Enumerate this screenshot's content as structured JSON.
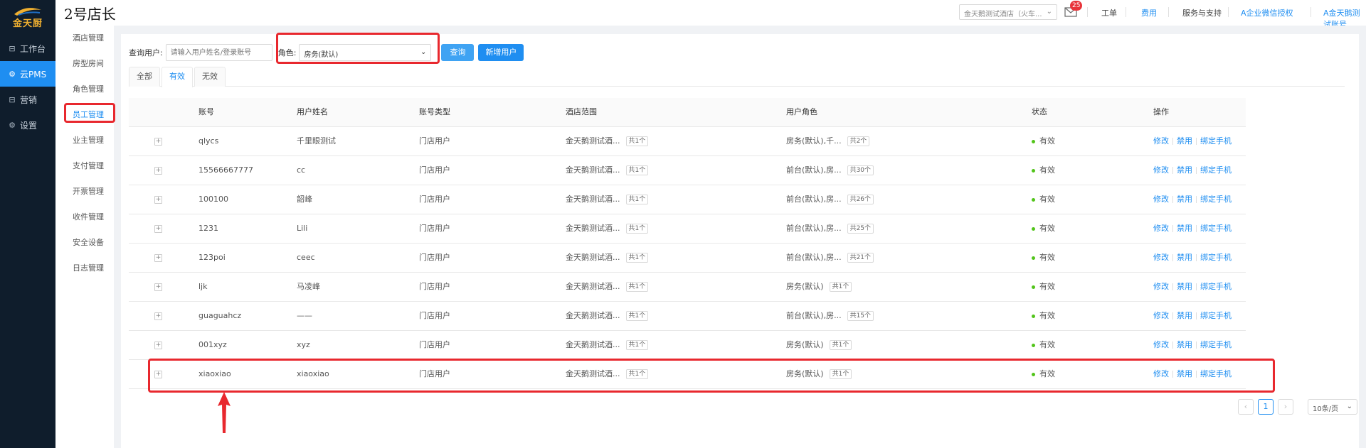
{
  "nav": {
    "brand": "金天厨",
    "items": [
      {
        "icon": "workbench-icon",
        "glyph": "⊟",
        "label": "工作台"
      },
      {
        "icon": "cloud-settings-icon",
        "glyph": "⚙",
        "label": "云PMS"
      },
      {
        "icon": "marketing-icon",
        "glyph": "⊟",
        "label": "营销"
      },
      {
        "icon": "settings-icon",
        "glyph": "⚙",
        "label": "设置"
      }
    ]
  },
  "header": {
    "store_name": "2号店长",
    "hotel_select": "金天鹅测试酒店（火车...",
    "mail_badge": "25",
    "links": {
      "work_order": "工单",
      "fees": "费用",
      "service": "服务与支持",
      "wechat": "A企业微信授权",
      "account": "A金天鹅测试账号"
    }
  },
  "submenu": [
    "酒店管理",
    "房型房间",
    "角色管理",
    "员工管理",
    "业主管理",
    "支付管理",
    "开票管理",
    "收件管理",
    "安全设备",
    "日志管理"
  ],
  "filter": {
    "user_label": "查询用户:",
    "user_placeholder": "请输入用户姓名/登录账号",
    "role_label": "角色:",
    "role_value": "房务(默认)",
    "query_button": "查询",
    "add_button": "新增用户"
  },
  "tabs": [
    "全部",
    "有效",
    "无效"
  ],
  "table": {
    "columns": [
      "账号",
      "用户姓名",
      "账号类型",
      "酒店范围",
      "用户角色",
      "状态",
      "操作"
    ],
    "actions": [
      "修改",
      "禁用",
      "绑定手机"
    ],
    "rows": [
      {
        "account": "qlycs",
        "name": "千里眼测试",
        "type": "门店用户",
        "hotel": "金天鹅测试酒...",
        "hotel_count": "共1个",
        "role": "房务(默认),千...",
        "role_count": "共2个",
        "status": "有效"
      },
      {
        "account": "15566667777",
        "name": "cc",
        "type": "门店用户",
        "hotel": "金天鹅测试酒...",
        "hotel_count": "共1个",
        "role": "前台(默认),房...",
        "role_count": "共30个",
        "status": "有效"
      },
      {
        "account": "100100",
        "name": "韶峰",
        "type": "门店用户",
        "hotel": "金天鹅测试酒...",
        "hotel_count": "共1个",
        "role": "前台(默认),房...",
        "role_count": "共26个",
        "status": "有效"
      },
      {
        "account": "1231",
        "name": "Lili",
        "type": "门店用户",
        "hotel": "金天鹅测试酒...",
        "hotel_count": "共1个",
        "role": "前台(默认),房...",
        "role_count": "共25个",
        "status": "有效"
      },
      {
        "account": "123poi",
        "name": "ceec",
        "type": "门店用户",
        "hotel": "金天鹅测试酒...",
        "hotel_count": "共1个",
        "role": "前台(默认),房...",
        "role_count": "共21个",
        "status": "有效"
      },
      {
        "account": "ljk",
        "name": "马凌峰",
        "type": "门店用户",
        "hotel": "金天鹅测试酒...",
        "hotel_count": "共1个",
        "role": "房务(默认)",
        "role_count": "共1个",
        "status": "有效"
      },
      {
        "account": "guaguahcz",
        "name": "——",
        "type": "门店用户",
        "hotel": "金天鹅测试酒...",
        "hotel_count": "共1个",
        "role": "前台(默认),房...",
        "role_count": "共15个",
        "status": "有效"
      },
      {
        "account": "001xyz",
        "name": "xyz",
        "type": "门店用户",
        "hotel": "金天鹅测试酒...",
        "hotel_count": "共1个",
        "role": "房务(默认)",
        "role_count": "共1个",
        "status": "有效"
      },
      {
        "account": "xiaoxiao",
        "name": "xiaoxiao",
        "type": "门店用户",
        "hotel": "金天鹅测试酒...",
        "hotel_count": "共1个",
        "role": "房务(默认)",
        "role_count": "共1个",
        "status": "有效"
      }
    ]
  },
  "pagination": {
    "current_page": "1",
    "page_size": "10条/页"
  },
  "colors": {
    "nav_bg": "#0f1d2c",
    "accent": "#1f8ef1",
    "annotation": "#e8282e",
    "status_ok": "#52c41a"
  }
}
